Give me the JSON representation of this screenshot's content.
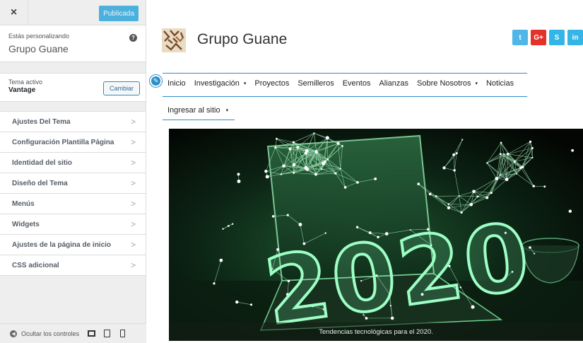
{
  "sidebar": {
    "close_label": "×",
    "publish_label": "Publicada",
    "customizing_label": "Estás personalizando",
    "site_name": "Grupo Guane",
    "help_label": "?",
    "active_theme_label": "Tema activo",
    "theme_name": "Vantage",
    "change_label": "Cambiar",
    "items": [
      {
        "label": "Ajustes Del Tema"
      },
      {
        "label": "Configuración Plantilla Página"
      },
      {
        "label": "Identidad del sitio"
      },
      {
        "label": "Diseño del Tema"
      },
      {
        "label": "Menús"
      },
      {
        "label": "Widgets"
      },
      {
        "label": "Ajustes de la página de inicio"
      },
      {
        "label": "CSS adicional"
      }
    ],
    "chevron": ">",
    "hide_controls_label": "Ocultar los controles"
  },
  "preview": {
    "site_title": "Grupo Guane",
    "social": [
      {
        "icon": "twitter-icon",
        "glyph": "t",
        "color": "#4fb6e8"
      },
      {
        "icon": "google-plus-icon",
        "glyph": "G+",
        "color": "#e3322a"
      },
      {
        "icon": "skype-icon",
        "glyph": "S",
        "color": "#33b5e8"
      },
      {
        "icon": "extra-social-icon",
        "glyph": "in",
        "color": "#33b5e8"
      }
    ],
    "nav": [
      {
        "label": "Inicio",
        "has_dropdown": false
      },
      {
        "label": "Investigación",
        "has_dropdown": true
      },
      {
        "label": "Proyectos",
        "has_dropdown": false
      },
      {
        "label": "Semilleros",
        "has_dropdown": false
      },
      {
        "label": "Eventos",
        "has_dropdown": false
      },
      {
        "label": "Alianzas",
        "has_dropdown": false
      },
      {
        "label": "Sobre Nosotros",
        "has_dropdown": true
      },
      {
        "label": "Noticias",
        "has_dropdown": false
      }
    ],
    "nav_second_row": {
      "label": "Ingresar al sitio",
      "has_dropdown": true
    },
    "caret": "▾",
    "hero_caption": "Tendencias tecnológicas para el 2020.",
    "hero_text": "2020"
  },
  "colors": {
    "accent": "#2b8ec8",
    "publish": "#4cb0dc",
    "hero_glow": "#5cf0a0"
  }
}
